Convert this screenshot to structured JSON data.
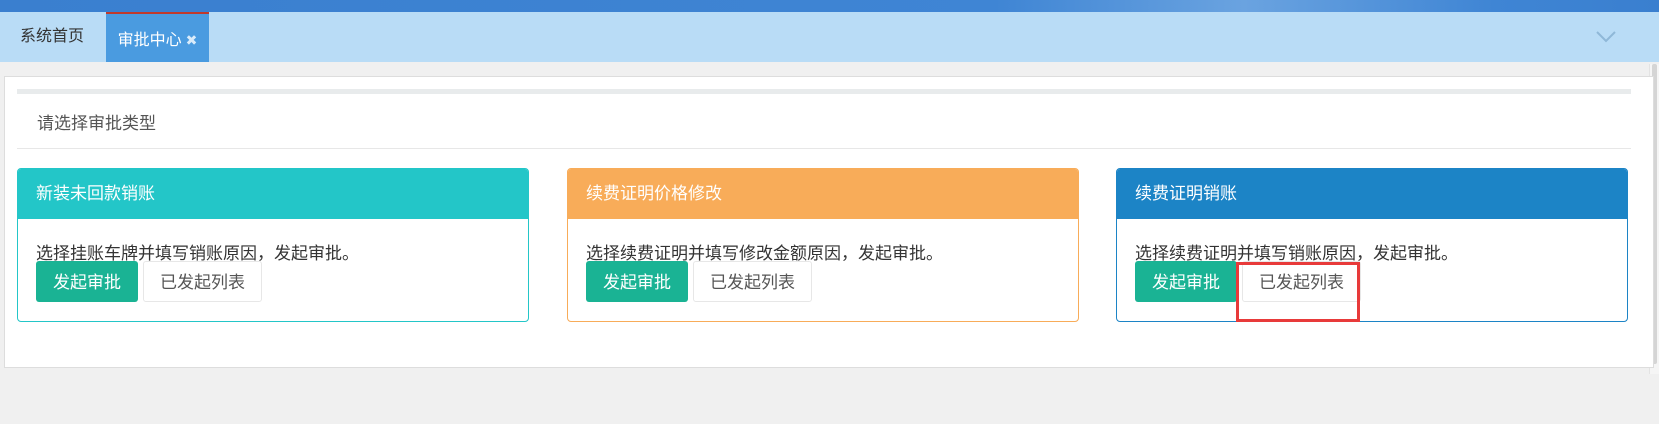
{
  "tabs": {
    "home": "系统首页",
    "active": "审批中心",
    "active_close": "✖"
  },
  "content": {
    "prompt": "请选择审批类型"
  },
  "cards": [
    {
      "title": "新装未回款销账",
      "description": "选择挂账车牌并填写销账原因，发起审批。",
      "primary_label": "发起审批",
      "secondary_label": "已发起列表",
      "color": "#23c6c8"
    },
    {
      "title": "续费证明价格修改",
      "description": "选择续费证明并填写修改金额原因，发起审批。",
      "primary_label": "发起审批",
      "secondary_label": "已发起列表",
      "color": "#f8ac59"
    },
    {
      "title": "续费证明销账",
      "description": "选择续费证明并填写销账原因，发起审批。",
      "primary_label": "发起审批",
      "secondary_label": "已发起列表",
      "color": "#1c84c6"
    }
  ],
  "colors": {
    "primary_button": "#1ab394",
    "highlight": "#e83a3a"
  }
}
